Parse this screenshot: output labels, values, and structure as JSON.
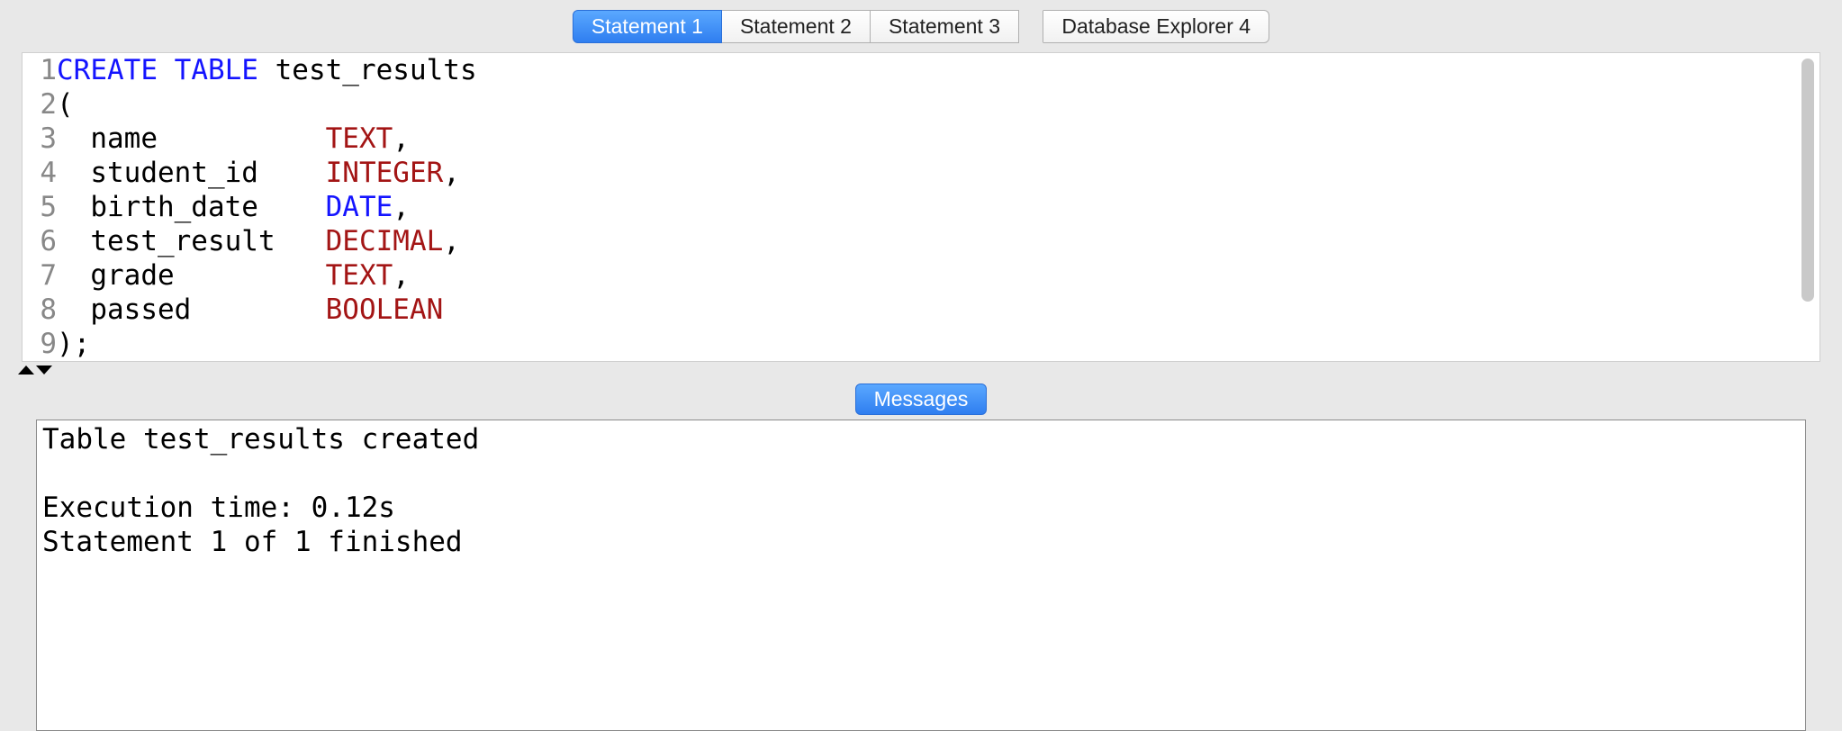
{
  "tabs": [
    {
      "label": "Statement 1",
      "active": true
    },
    {
      "label": "Statement 2",
      "active": false
    },
    {
      "label": "Statement 3",
      "active": false
    },
    {
      "label": "Database Explorer 4",
      "active": false
    }
  ],
  "editor": {
    "lines": [
      {
        "num": "1",
        "segments": [
          {
            "cls": "kw-blue",
            "t": "CREATE"
          },
          {
            "cls": "plain",
            "t": " "
          },
          {
            "cls": "kw-blue",
            "t": "TABLE"
          },
          {
            "cls": "plain",
            "t": " test_results"
          }
        ]
      },
      {
        "num": "2",
        "segments": [
          {
            "cls": "plain",
            "t": "("
          }
        ]
      },
      {
        "num": "3",
        "segments": [
          {
            "cls": "plain",
            "t": "  name          "
          },
          {
            "cls": "kw-red",
            "t": "TEXT"
          },
          {
            "cls": "plain",
            "t": ","
          }
        ]
      },
      {
        "num": "4",
        "segments": [
          {
            "cls": "plain",
            "t": "  student_id    "
          },
          {
            "cls": "kw-red",
            "t": "INTEGER"
          },
          {
            "cls": "plain",
            "t": ","
          }
        ]
      },
      {
        "num": "5",
        "segments": [
          {
            "cls": "plain",
            "t": "  birth_date    "
          },
          {
            "cls": "kw-blue",
            "t": "DATE"
          },
          {
            "cls": "plain",
            "t": ","
          }
        ]
      },
      {
        "num": "6",
        "segments": [
          {
            "cls": "plain",
            "t": "  test_result   "
          },
          {
            "cls": "kw-red",
            "t": "DECIMAL"
          },
          {
            "cls": "plain",
            "t": ","
          }
        ]
      },
      {
        "num": "7",
        "segments": [
          {
            "cls": "plain",
            "t": "  grade         "
          },
          {
            "cls": "kw-red",
            "t": "TEXT"
          },
          {
            "cls": "plain",
            "t": ","
          }
        ]
      },
      {
        "num": "8",
        "segments": [
          {
            "cls": "plain",
            "t": "  passed        "
          },
          {
            "cls": "kw-red",
            "t": "BOOLEAN"
          }
        ]
      },
      {
        "num": "9",
        "segments": [
          {
            "cls": "plain",
            "t": ");"
          }
        ]
      }
    ]
  },
  "bottom_tabs": [
    {
      "label": "Messages",
      "active": true
    }
  ],
  "messages_output": "Table test_results created\n\nExecution time: 0.12s\nStatement 1 of 1 finished"
}
